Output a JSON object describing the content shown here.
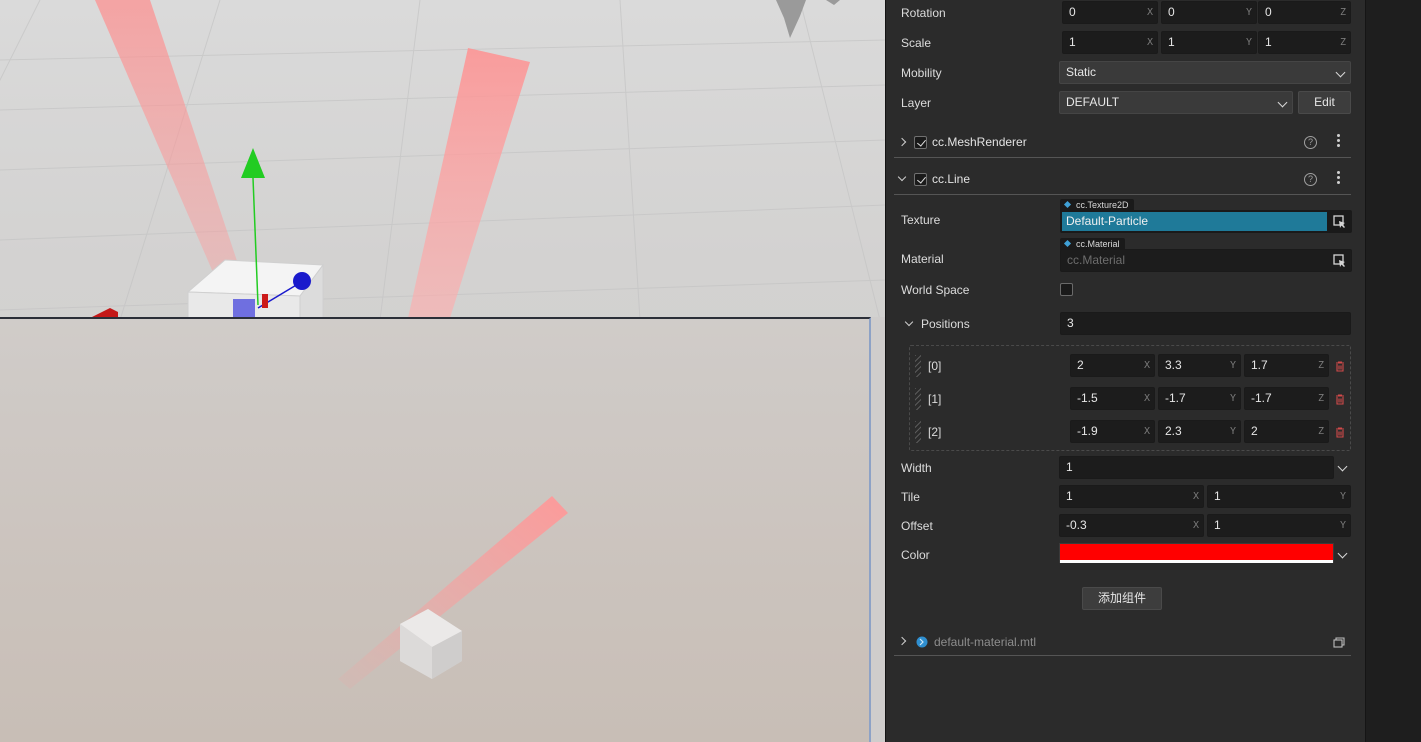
{
  "inspector": {
    "rotation": {
      "label": "Rotation",
      "x": "0",
      "y": "0",
      "z": "0"
    },
    "scale": {
      "label": "Scale",
      "x": "1",
      "y": "1",
      "z": "1"
    },
    "mobility": {
      "label": "Mobility",
      "value": "Static"
    },
    "layer": {
      "label": "Layer",
      "value": "DEFAULT",
      "edit_label": "Edit"
    },
    "axis_labels": {
      "x": "X",
      "y": "Y",
      "z": "Z"
    },
    "mesh_renderer": {
      "title": "cc.MeshRenderer",
      "enabled": true
    },
    "line": {
      "title": "cc.Line",
      "enabled": true,
      "texture": {
        "label": "Texture",
        "asset_type": "cc.Texture2D",
        "value": "Default-Particle"
      },
      "material": {
        "label": "Material",
        "asset_type": "cc.Material",
        "placeholder": "cc.Material"
      },
      "world_space": {
        "label": "World Space",
        "checked": false
      },
      "positions": {
        "label": "Positions",
        "count": "3",
        "items": [
          {
            "index": "[0]",
            "x": "2",
            "y": "3.3",
            "z": "1.7"
          },
          {
            "index": "[1]",
            "x": "-1.5",
            "y": "-1.7",
            "z": "-1.7"
          },
          {
            "index": "[2]",
            "x": "-1.9",
            "y": "2.3",
            "z": "2"
          }
        ]
      },
      "width": {
        "label": "Width",
        "value": "1"
      },
      "tile": {
        "label": "Tile",
        "x": "1",
        "y": "1"
      },
      "offset": {
        "label": "Offset",
        "x": "-0.3",
        "y": "1"
      },
      "color": {
        "label": "Color",
        "value": "#ff0000"
      }
    },
    "add_component_label": "添加组件",
    "material_asset": {
      "name": "default-material.mtl"
    }
  },
  "colors": {
    "panel_bg": "#2b2b2b",
    "field_bg": "#1c1c1c",
    "texture_highlight": "#1f7a99",
    "line_color": "#ff0000",
    "gizmo_y": "#22cc22",
    "gizmo_z": "#1a1acc",
    "gizmo_x": "#cc1a1a"
  }
}
